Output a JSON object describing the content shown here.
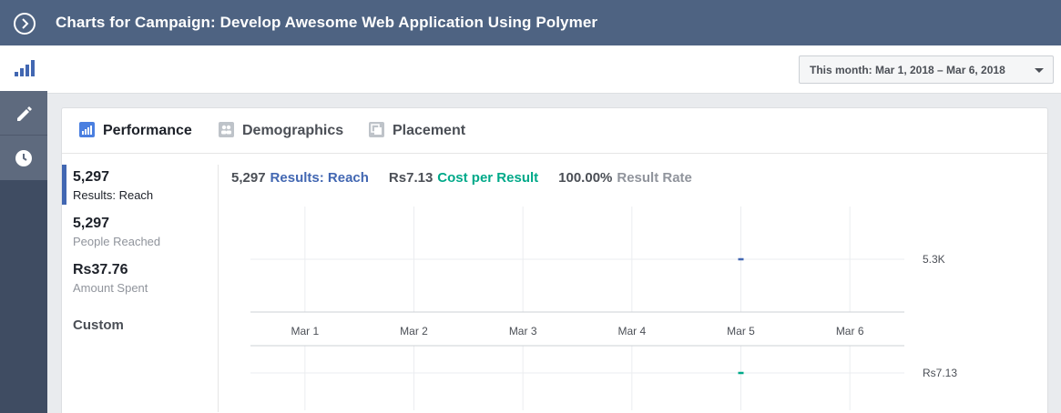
{
  "header": {
    "title": "Charts for Campaign: Develop Awesome Web Application Using Polymer"
  },
  "date_range": {
    "label": "This month: Mar 1, 2018 – Mar 6, 2018"
  },
  "tabs": [
    {
      "label": "Performance",
      "active": true,
      "icon": "bar-chart-icon"
    },
    {
      "label": "Demographics",
      "active": false,
      "icon": "people-icon"
    },
    {
      "label": "Placement",
      "active": false,
      "icon": "placement-icon"
    }
  ],
  "metrics": [
    {
      "value": "5,297",
      "label": "Results: Reach",
      "active": true
    },
    {
      "value": "5,297",
      "label": "People Reached",
      "active": false
    },
    {
      "value": "Rs37.76",
      "label": "Amount Spent",
      "active": false
    }
  ],
  "custom_label": "Custom",
  "summary": {
    "results_value": "5,297",
    "results_label": "Results: Reach",
    "cost_value": "Rs7.13",
    "cost_label": "Cost per Result",
    "rate_value": "100.00%",
    "rate_label": "Result Rate"
  },
  "colors": {
    "header_bg": "#4e6382",
    "accent_blue": "#4267b2",
    "accent_green": "#00a989"
  },
  "chart_data": {
    "type": "line",
    "categories": [
      "Mar 1",
      "Mar 2",
      "Mar 3",
      "Mar 4",
      "Mar 5",
      "Mar 6"
    ],
    "series": [
      {
        "name": "Results: Reach",
        "values": [
          null,
          null,
          null,
          null,
          5297,
          null
        ],
        "color": "#4267b2",
        "y_label": "5.3K"
      },
      {
        "name": "Cost per Result",
        "values": [
          null,
          null,
          null,
          null,
          7.13,
          null
        ],
        "color": "#00a989",
        "y_label": "Rs7.13"
      }
    ],
    "grid": true
  }
}
